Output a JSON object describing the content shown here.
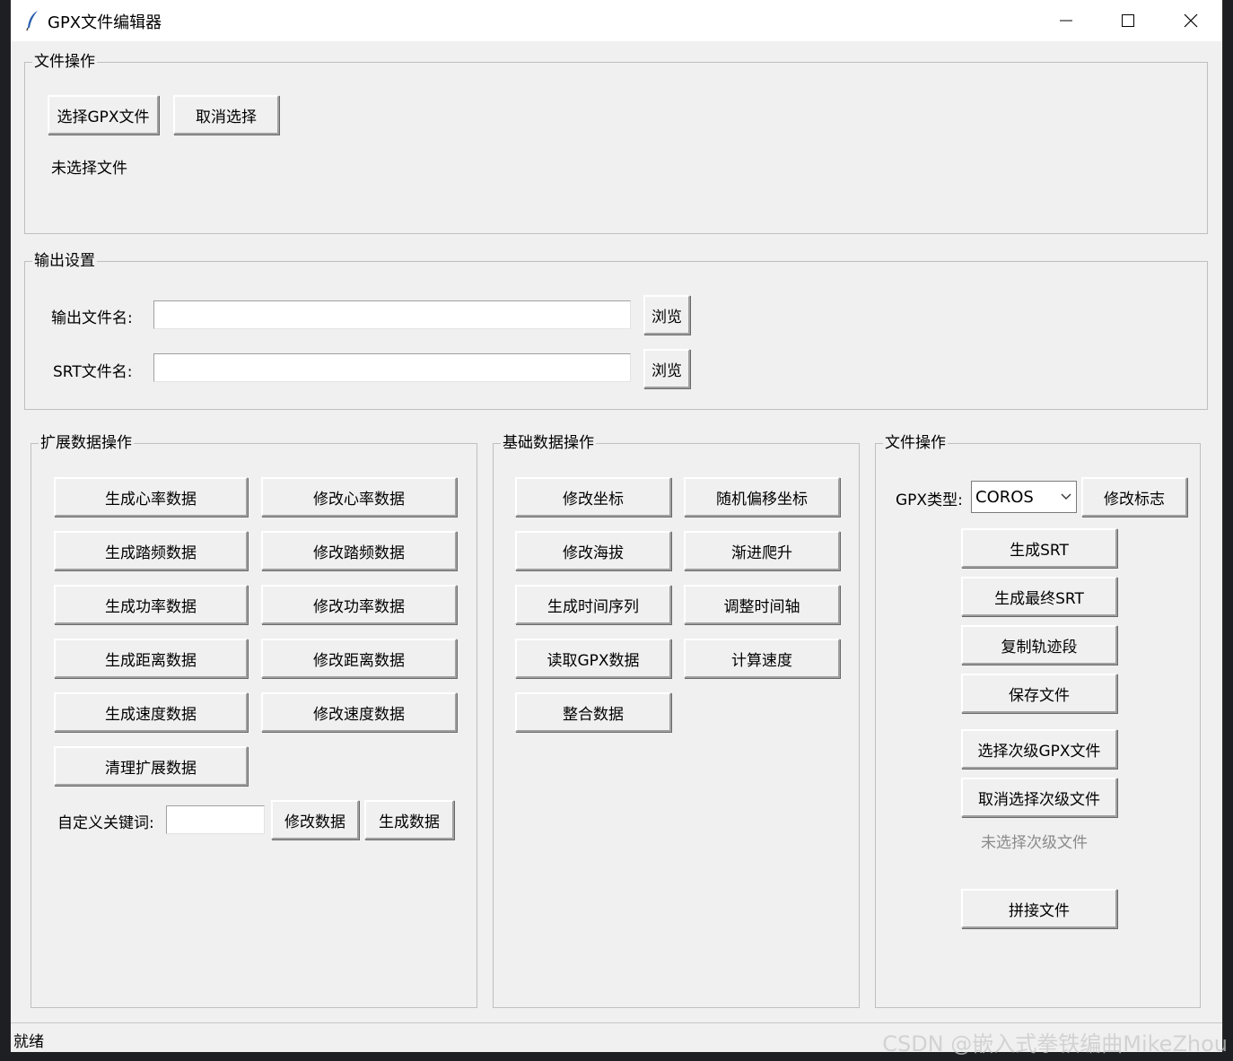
{
  "window": {
    "title": "GPX文件编辑器",
    "controls": {
      "minimize": "minimize-icon",
      "maximize": "maximize-icon",
      "close": "close-icon"
    }
  },
  "file_ops": {
    "label": "文件操作",
    "select_button": "选择GPX文件",
    "cancel_button": "取消选择",
    "status": "未选择文件"
  },
  "output": {
    "label": "输出设置",
    "output_name_label": "输出文件名:",
    "output_name_value": "",
    "srt_name_label": "SRT文件名:",
    "srt_name_value": "",
    "browse_label": "浏览"
  },
  "extended": {
    "label": "扩展数据操作",
    "buttons": [
      "生成心率数据",
      "修改心率数据",
      "生成踏频数据",
      "修改踏频数据",
      "生成功率数据",
      "修改功率数据",
      "生成距离数据",
      "修改距离数据",
      "生成速度数据",
      "修改速度数据",
      "清理扩展数据"
    ],
    "keyword_label": "自定义关键词:",
    "keyword_value": "",
    "modify_button": "修改数据",
    "generate_button": "生成数据"
  },
  "basic": {
    "label": "基础数据操作",
    "buttons": [
      "修改坐标",
      "随机偏移坐标",
      "修改海拔",
      "渐进爬升",
      "生成时间序列",
      "调整时间轴",
      "读取GPX数据",
      "计算速度",
      "整合数据"
    ]
  },
  "file_ops2": {
    "label": "文件操作",
    "gpx_type_label": "GPX类型:",
    "gpx_type_value": "COROS",
    "modify_flag_button": "修改标志",
    "buttons": [
      "生成SRT",
      "生成最终SRT",
      "复制轨迹段",
      "保存文件",
      "选择次级GPX文件",
      "取消选择次级文件"
    ],
    "secondary_status": "未选择次级文件",
    "merge_button": "拼接文件",
    "secondary_status_color": "#8a8a8a"
  },
  "statusbar": {
    "text": "就绪"
  },
  "watermark": "CSDN @嵌入式拳铁编曲MikeZhou"
}
